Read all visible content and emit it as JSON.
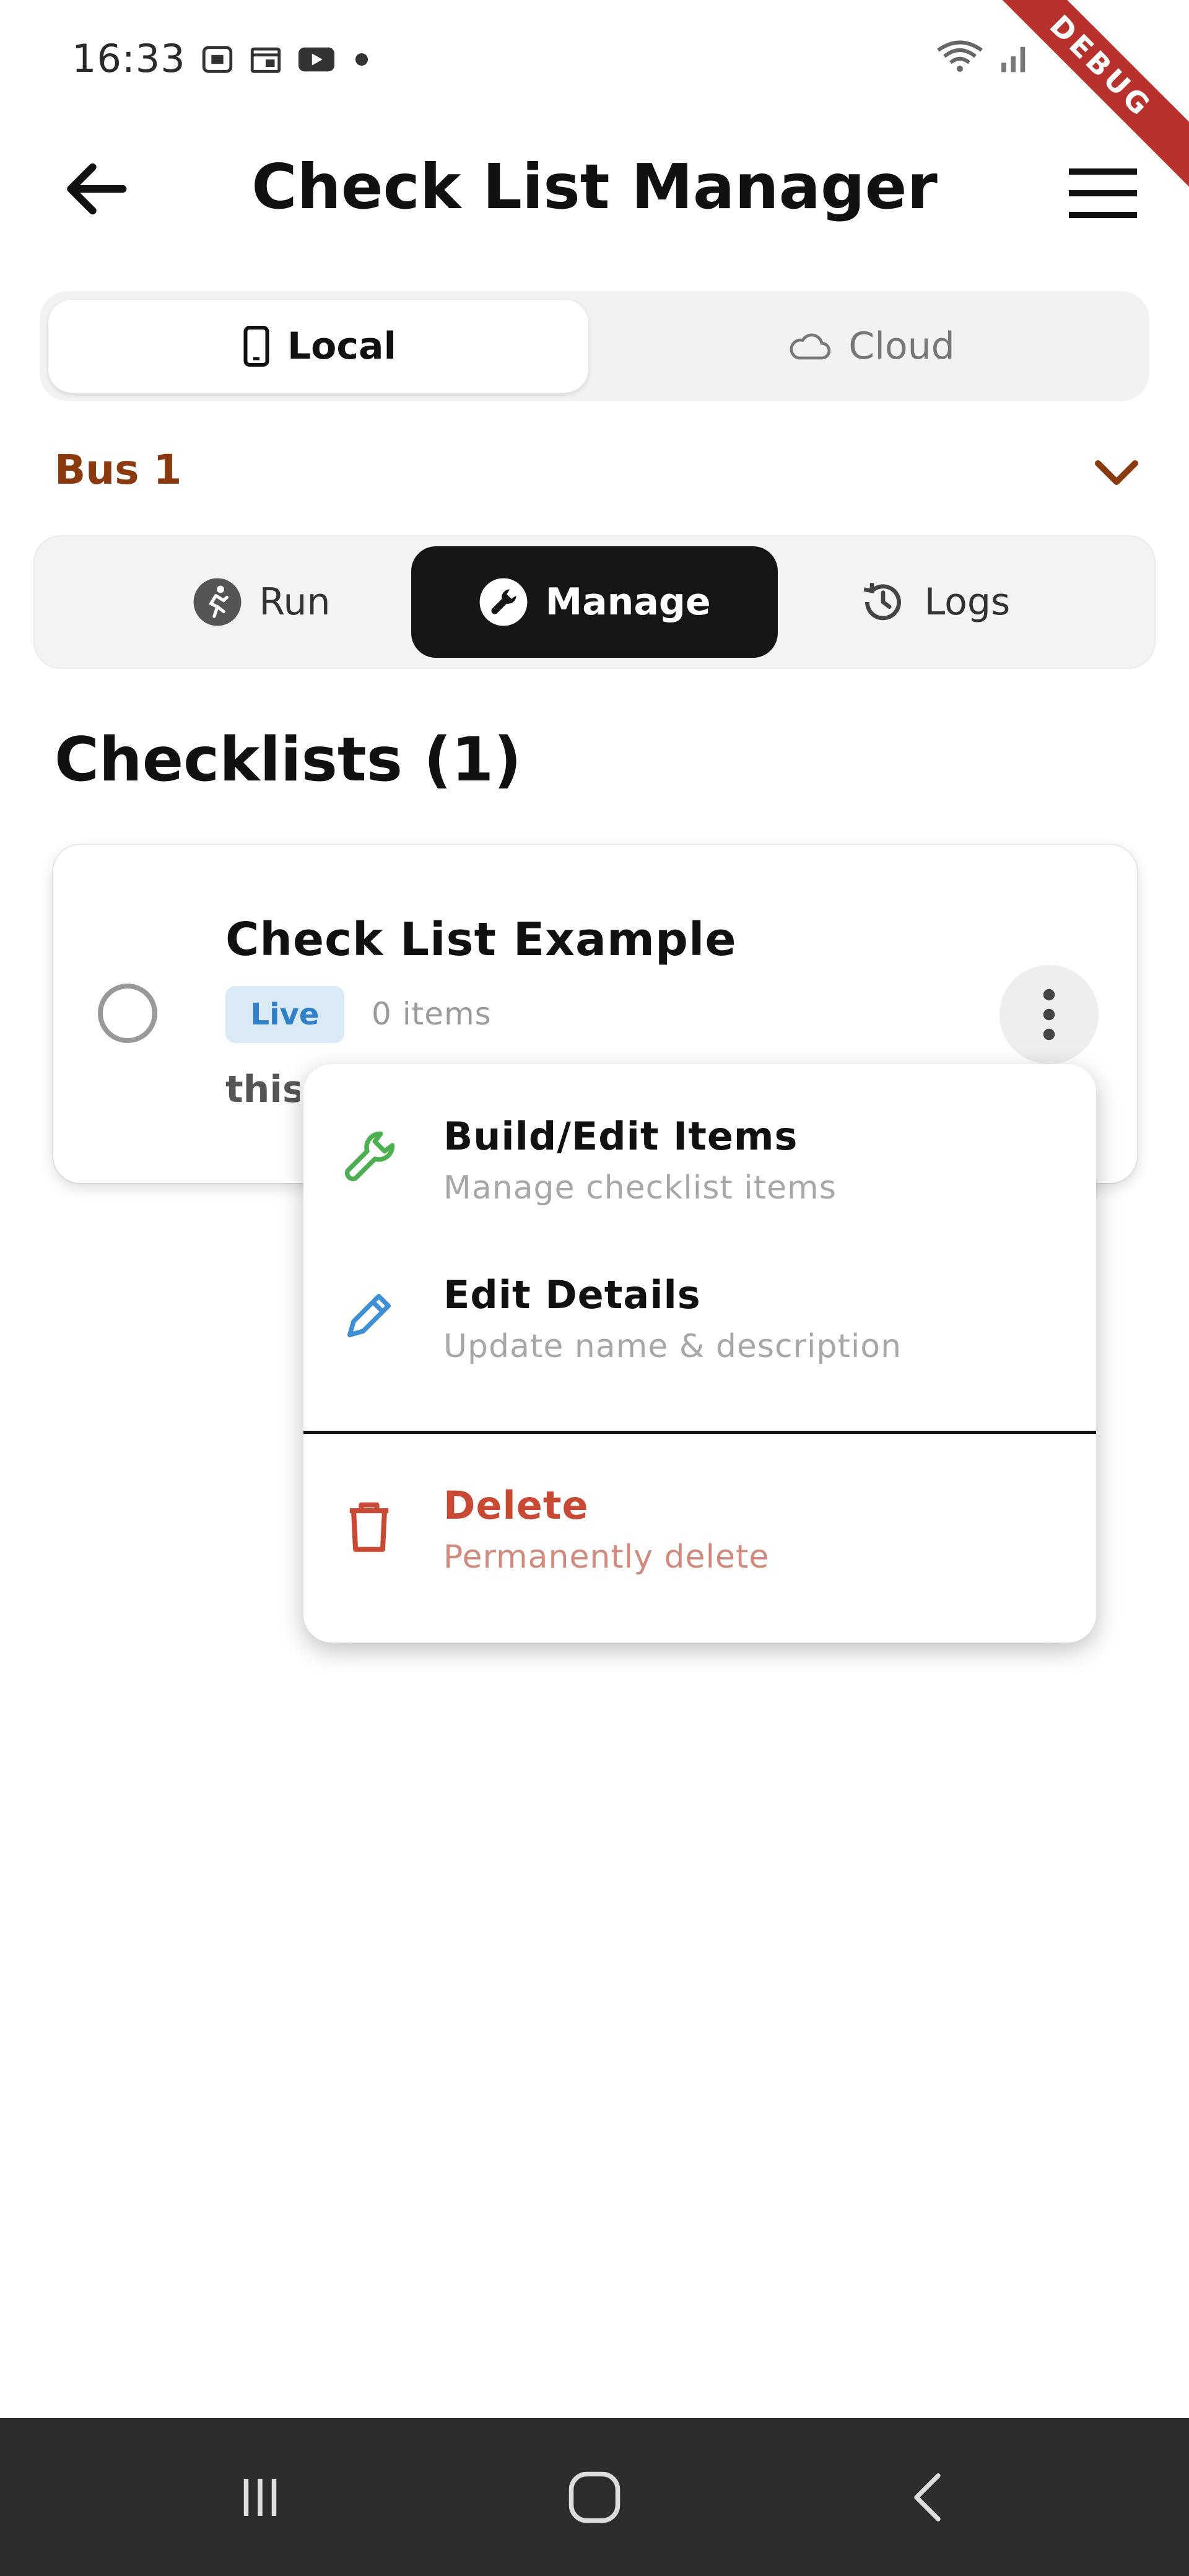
{
  "status_bar": {
    "time": "16:33",
    "icons": [
      "screenshot-icon",
      "calendar-icon",
      "youtube-icon",
      "dot-icon"
    ],
    "right_icons": [
      "wifi-icon",
      "signal-icon"
    ]
  },
  "debug_banner": "DEBUG",
  "header": {
    "title": "Check List Manager",
    "back_icon": "arrow-left-icon",
    "menu_icon": "hamburger-menu-icon"
  },
  "storage_tabs": {
    "active": "Local",
    "items": [
      {
        "label": "Local",
        "icon": "phone-icon"
      },
      {
        "label": "Cloud",
        "icon": "cloud-icon"
      }
    ]
  },
  "bus_selector": {
    "value": "Bus 1",
    "accent": "#8b3a0f"
  },
  "mode_tabs": {
    "active": "Manage",
    "items": [
      {
        "label": "Run",
        "icon": "run-icon"
      },
      {
        "label": "Manage",
        "icon": "wrench-icon"
      },
      {
        "label": "Logs",
        "icon": "history-icon"
      }
    ]
  },
  "section": {
    "title": "Checklists (1)"
  },
  "checklists": [
    {
      "name": "Check List Example",
      "status_badge": "Live",
      "item_count": "0 items",
      "description": "this"
    }
  ],
  "context_menu": {
    "items": [
      {
        "label": "Build/Edit Items",
        "sub": "Manage checklist items",
        "icon": "wrench-icon",
        "color": "#4caf50"
      },
      {
        "label": "Edit Details",
        "sub": "Update name & description",
        "icon": "pencil-icon",
        "color": "#3d8fd6"
      },
      {
        "label": "Delete",
        "sub": "Permanently delete",
        "icon": "trash-icon",
        "color": "#c84a34"
      }
    ]
  },
  "colors": {
    "accent_dark": "#161616",
    "live_badge_bg": "#dbeaf7",
    "live_badge_text": "#2f7fc9",
    "debug_ribbon": "#b8322d"
  }
}
